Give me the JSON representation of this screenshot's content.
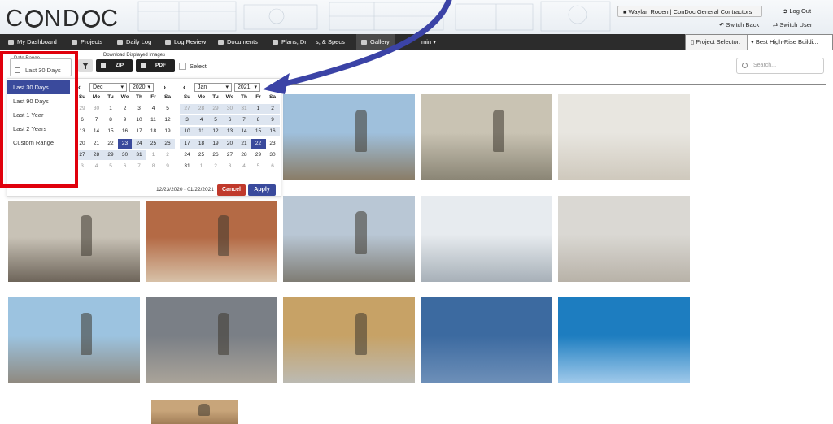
{
  "brand": {
    "logo_text": "C ND C",
    "logo_left": "C",
    "logo_mid": "ND",
    "logo_right": "C"
  },
  "header": {
    "user": "Waylan Roden  | ConDoc General Contractors",
    "log_out": "Log Out",
    "switch_back": "Switch Back",
    "switch_user": "Switch User"
  },
  "nav": {
    "items": [
      "My Dashboard",
      "Projects",
      "Daily Log",
      "Log Review",
      "Documents",
      "Plans, Dr",
      "s, & Specs",
      "Gallery",
      "min"
    ],
    "project_selector_label": "Project Selector:",
    "project_selector_value": "Best High-Rise Buildi..."
  },
  "toolbar": {
    "date_range_label": "Date Range",
    "date_range_value": "Last 30 Days",
    "download_label": "Download Displayed Images",
    "zip": "ZIP",
    "pdf": "PDF",
    "select": "Select",
    "search_placeholder": "Search..."
  },
  "picker": {
    "ranges": [
      "Last 30 Days",
      "Last 90 Days",
      "Last 1 Year",
      "Last 2 Years",
      "Custom Range"
    ],
    "left_month": "Dec",
    "left_year": "2020",
    "right_month": "Jan",
    "right_year": "2021",
    "dow": [
      "Su",
      "Mo",
      "Tu",
      "We",
      "Th",
      "Fr",
      "Sa"
    ],
    "left_days": [
      "29",
      "30",
      "1",
      "2",
      "3",
      "4",
      "5",
      "6",
      "7",
      "8",
      "9",
      "10",
      "11",
      "12",
      "13",
      "14",
      "15",
      "16",
      "17",
      "18",
      "19",
      "20",
      "21",
      "22",
      "23",
      "24",
      "25",
      "26",
      "27",
      "28",
      "29",
      "30",
      "31",
      "1",
      "2",
      "3",
      "4",
      "5",
      "6",
      "7",
      "8",
      "9"
    ],
    "right_days": [
      "27",
      "28",
      "29",
      "30",
      "31",
      "1",
      "2",
      "3",
      "4",
      "5",
      "6",
      "7",
      "8",
      "9",
      "10",
      "11",
      "12",
      "13",
      "14",
      "15",
      "16",
      "17",
      "18",
      "19",
      "20",
      "21",
      "22",
      "23",
      "24",
      "25",
      "26",
      "27",
      "28",
      "29",
      "30",
      "31",
      "1",
      "2",
      "3",
      "4",
      "5",
      "6"
    ],
    "range_text": "12/23/2020 - 01/22/2021",
    "cancel": "Cancel",
    "apply": "Apply"
  },
  "colors": {
    "accent": "#3a4a9c",
    "cancel": "#c0392b",
    "highlight": "#e0000c",
    "arrow": "#3b43a6",
    "nav_bg": "#2c2c2c"
  }
}
